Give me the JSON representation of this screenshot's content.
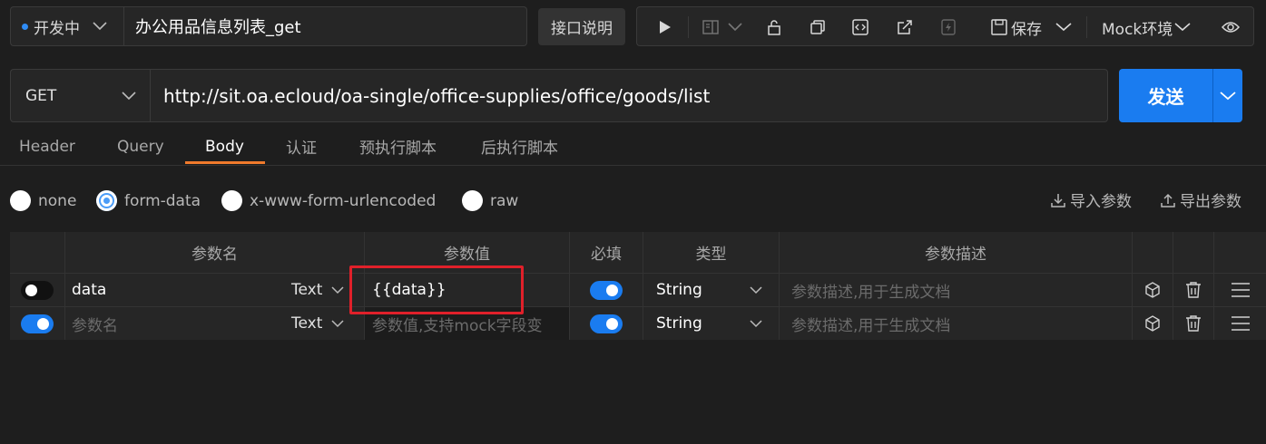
{
  "top_bar": {
    "status": "开发中",
    "api_name": "办公用品信息列表_get",
    "api_doc_button": "接口说明",
    "save_label": "保存",
    "env_label": "Mock环境"
  },
  "request": {
    "method": "GET",
    "url": "http://sit.oa.ecloud/oa-single/office-supplies/office/goods/list",
    "send_label": "发送"
  },
  "tabs": [
    "Header",
    "Query",
    "Body",
    "认证",
    "预执行脚本",
    "后执行脚本"
  ],
  "active_tab": "Body",
  "body_types": [
    "none",
    "form-data",
    "x-www-form-urlencoded",
    "raw"
  ],
  "selected_body_type": "form-data",
  "import_label": "导入参数",
  "export_label": "导出参数",
  "table": {
    "headers": [
      "参数名",
      "参数值",
      "必填",
      "类型",
      "参数描述"
    ],
    "rows": [
      {
        "enabled": false,
        "name": "data",
        "name_placeholder": "",
        "value_type": "Text",
        "value": "{{data}}",
        "value_placeholder": "",
        "required": true,
        "type": "String",
        "description_placeholder": "参数描述,用于生成文档"
      },
      {
        "enabled": true,
        "name": "",
        "name_placeholder": "参数名",
        "value_type": "Text",
        "value": "",
        "value_placeholder": "参数值,支持mock字段变",
        "required": true,
        "type": "String",
        "description_placeholder": "参数描述,用于生成文档"
      }
    ]
  },
  "colors": {
    "accent": "#1a7cf0",
    "tab_underline": "#f07a2c",
    "highlight": "#e0202a"
  }
}
